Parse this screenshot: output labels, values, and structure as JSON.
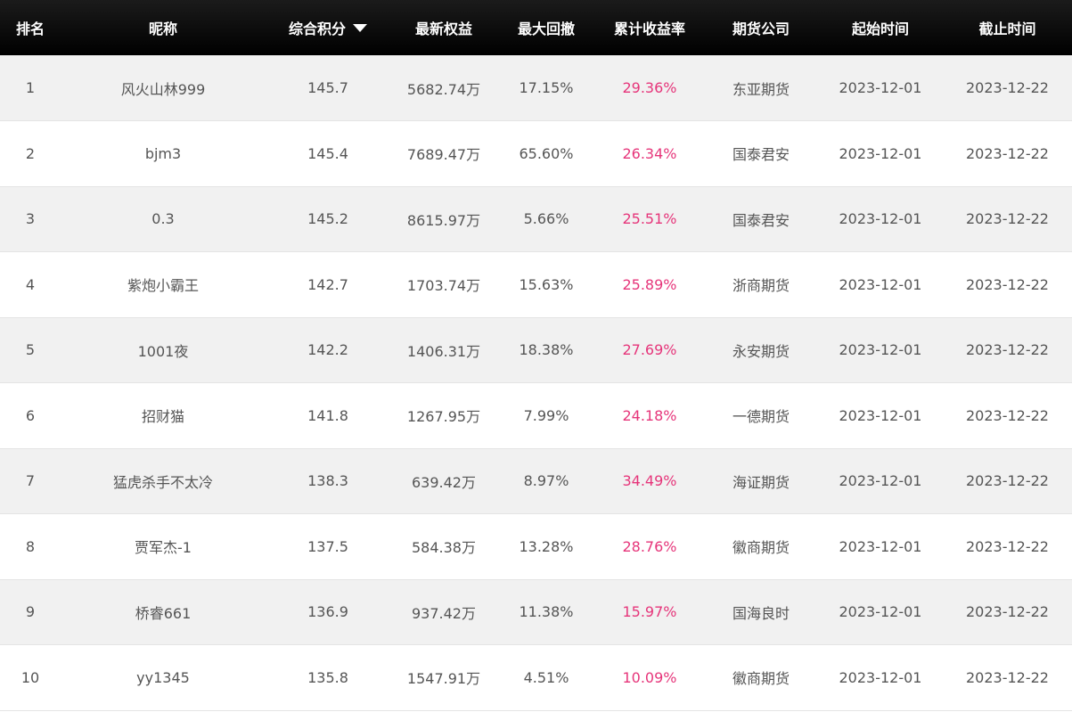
{
  "headers": {
    "rank": "排名",
    "nickname": "昵称",
    "score": "综合积分",
    "equity": "最新权益",
    "drawdown": "最大回撤",
    "return": "累计收益率",
    "broker": "期货公司",
    "start": "起始时间",
    "end": "截止时间"
  },
  "sort": {
    "column": "score",
    "direction": "desc",
    "icon": "caret-down-icon"
  },
  "colors": {
    "header_bg": "#000000",
    "header_text": "#ffffff",
    "row_alt_bg": "#f1f1f1",
    "text": "#555555",
    "return_text": "#e6357a"
  },
  "rows": [
    {
      "rank": "1",
      "nickname": "风火山林999",
      "score": "145.7",
      "equity": "5682.74万",
      "drawdown": "17.15%",
      "return": "29.36%",
      "broker": "东亚期货",
      "start": "2023-12-01",
      "end": "2023-12-22"
    },
    {
      "rank": "2",
      "nickname": "bjm3",
      "score": "145.4",
      "equity": "7689.47万",
      "drawdown": "65.60%",
      "return": "26.34%",
      "broker": "国泰君安",
      "start": "2023-12-01",
      "end": "2023-12-22"
    },
    {
      "rank": "3",
      "nickname": "0.3",
      "score": "145.2",
      "equity": "8615.97万",
      "drawdown": "5.66%",
      "return": "25.51%",
      "broker": "国泰君安",
      "start": "2023-12-01",
      "end": "2023-12-22"
    },
    {
      "rank": "4",
      "nickname": "紫炮小霸王",
      "score": "142.7",
      "equity": "1703.74万",
      "drawdown": "15.63%",
      "return": "25.89%",
      "broker": "浙商期货",
      "start": "2023-12-01",
      "end": "2023-12-22"
    },
    {
      "rank": "5",
      "nickname": "1001夜",
      "score": "142.2",
      "equity": "1406.31万",
      "drawdown": "18.38%",
      "return": "27.69%",
      "broker": "永安期货",
      "start": "2023-12-01",
      "end": "2023-12-22"
    },
    {
      "rank": "6",
      "nickname": "招财猫",
      "score": "141.8",
      "equity": "1267.95万",
      "drawdown": "7.99%",
      "return": "24.18%",
      "broker": "一德期货",
      "start": "2023-12-01",
      "end": "2023-12-22"
    },
    {
      "rank": "7",
      "nickname": "猛虎杀手不太冷",
      "score": "138.3",
      "equity": "639.42万",
      "drawdown": "8.97%",
      "return": "34.49%",
      "broker": "海证期货",
      "start": "2023-12-01",
      "end": "2023-12-22"
    },
    {
      "rank": "8",
      "nickname": "贾军杰-1",
      "score": "137.5",
      "equity": "584.38万",
      "drawdown": "13.28%",
      "return": "28.76%",
      "broker": "徽商期货",
      "start": "2023-12-01",
      "end": "2023-12-22"
    },
    {
      "rank": "9",
      "nickname": "桥睿661",
      "score": "136.9",
      "equity": "937.42万",
      "drawdown": "11.38%",
      "return": "15.97%",
      "broker": "国海良时",
      "start": "2023-12-01",
      "end": "2023-12-22"
    },
    {
      "rank": "10",
      "nickname": "yy1345",
      "score": "135.8",
      "equity": "1547.91万",
      "drawdown": "4.51%",
      "return": "10.09%",
      "broker": "徽商期货",
      "start": "2023-12-01",
      "end": "2023-12-22"
    }
  ]
}
